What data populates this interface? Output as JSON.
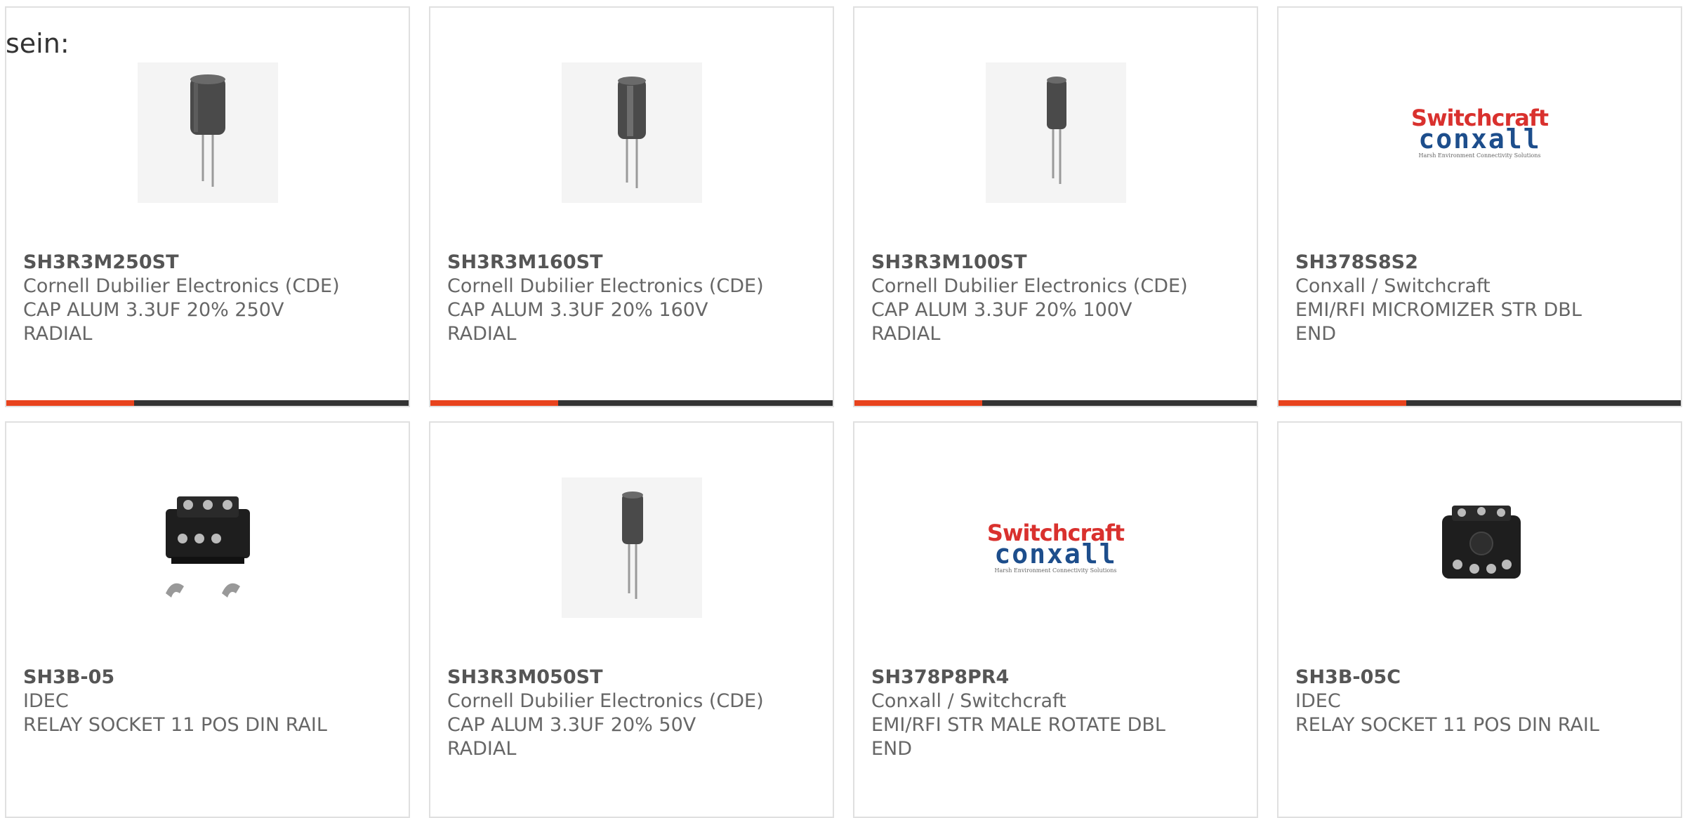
{
  "intro_text": "sein:",
  "brand": {
    "accent_color": "#e8431d",
    "bar_color": "#333333",
    "logo_red": "#d9312e",
    "logo_blue": "#1d4e8c"
  },
  "logo": {
    "top": "Switchcraft",
    "bottom": "conxall",
    "tagline": "Harsh Environment Connectivity Solutions"
  },
  "products": [
    {
      "part": "SH3R3M250ST",
      "manufacturer": "Cornell Dubilier Electronics (CDE)",
      "description": "CAP ALUM 3.3UF 20% 250V RADIAL",
      "image": "capacitor-icon"
    },
    {
      "part": "SH3R3M160ST",
      "manufacturer": "Cornell Dubilier Electronics (CDE)",
      "description": "CAP ALUM 3.3UF 20% 160V RADIAL",
      "image": "capacitor-icon"
    },
    {
      "part": "SH3R3M100ST",
      "manufacturer": "Cornell Dubilier Electronics (CDE)",
      "description": "CAP ALUM 3.3UF 20% 100V RADIAL",
      "image": "capacitor-icon"
    },
    {
      "part": "SH378S8S2",
      "manufacturer": "Conxall / Switchcraft",
      "description": "EMI/RFI MICROMIZER STR DBL END",
      "image": "switchcraft-conxall-logo"
    },
    {
      "part": "SH3B-05",
      "manufacturer": "IDEC",
      "description": "RELAY SOCKET 11 POS DIN RAIL",
      "image": "relay-socket-icon"
    },
    {
      "part": "SH3R3M050ST",
      "manufacturer": "Cornell Dubilier Electronics (CDE)",
      "description": "CAP ALUM 3.3UF 20% 50V RADIAL",
      "image": "capacitor-icon"
    },
    {
      "part": "SH378P8PR4",
      "manufacturer": "Conxall / Switchcraft",
      "description": "EMI/RFI STR MALE ROTATE DBL END",
      "image": "switchcraft-conxall-logo"
    },
    {
      "part": "SH3B-05C",
      "manufacturer": "IDEC",
      "description": "RELAY SOCKET 11 POS DIN RAIL",
      "image": "relay-socket-icon"
    }
  ]
}
